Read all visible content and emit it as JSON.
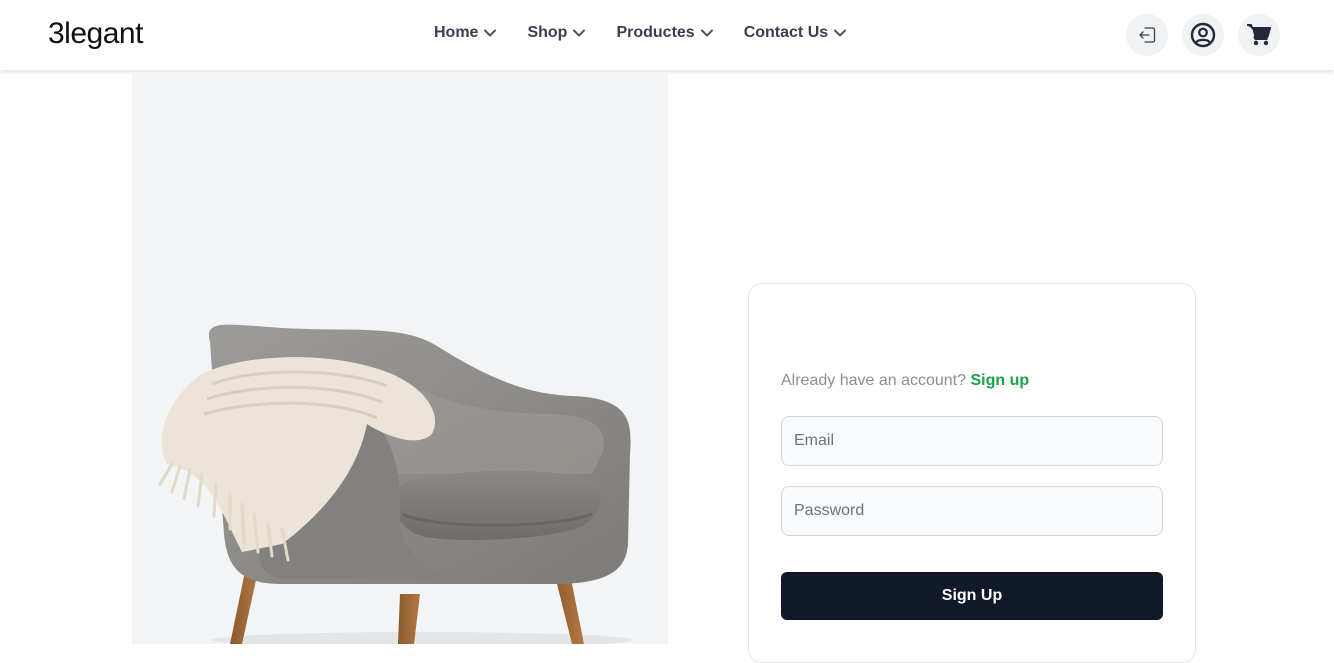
{
  "header": {
    "logo": "3legant",
    "nav": [
      {
        "label": "Home"
      },
      {
        "label": "Shop"
      },
      {
        "label": "Productes"
      },
      {
        "label": "Contact Us"
      }
    ],
    "icons": [
      "logout-icon",
      "account-icon",
      "cart-icon"
    ]
  },
  "hero": {
    "image": "armchair-with-blanket"
  },
  "form": {
    "already_text": "Already have an account?",
    "signin_link": "Sign up",
    "email_placeholder": "Email",
    "password_placeholder": "Password",
    "submit_label": "Sign Up"
  },
  "colors": {
    "accent": "#16a34a",
    "button": "#111827",
    "image_bg": "#f2f4f5"
  }
}
